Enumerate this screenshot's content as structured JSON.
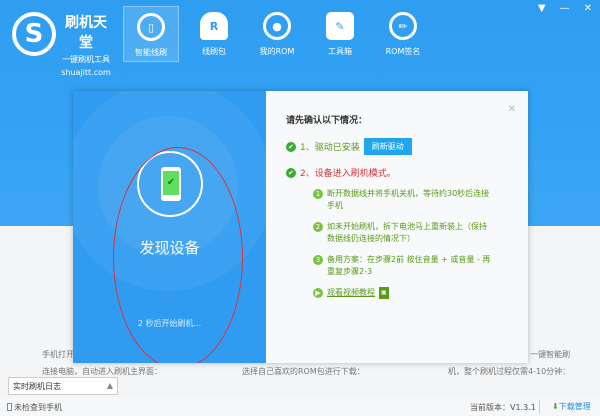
{
  "brand": {
    "name": "刷机天堂",
    "tagline": "一键刷机工具",
    "site": "shuajitt.com"
  },
  "nav": [
    {
      "label": "智能线刷",
      "icon": "phone-refresh-icon"
    },
    {
      "label": "线刷包",
      "icon": "cloud-download-icon"
    },
    {
      "label": "我的ROM",
      "icon": "user-icon"
    },
    {
      "label": "工具箱",
      "icon": "wrench-icon"
    },
    {
      "label": "ROM签名",
      "icon": "pencil-icon"
    }
  ],
  "window": {
    "menu": "▼",
    "minimize": "—",
    "close": "✕"
  },
  "background_hints": {
    "left": [
      "手机打开",
      "连接电脑，自动进入刷机主界面："
    ],
    "center": "选择自己喜欢的ROM包进行下载：",
    "right": [
      "一键智能刷",
      "机，整个刷机过程仅需4-10分钟："
    ]
  },
  "modal": {
    "found_title": "发现设备",
    "countdown": "2 秒后开始刷机...",
    "confirm_title": "请先确认以下情况：",
    "check1": "1、驱动已安装",
    "refresh_driver": "刷新驱动",
    "check2": "2、设备进入刷机模式。",
    "steps": [
      {
        "num": "1",
        "text": "断开数据线并将手机关机，等待约30秒后连接手机"
      },
      {
        "num": "2",
        "text": "如未开始刷机，拆下电池马上重新装上（保持数据线仍连接的情况下）"
      },
      {
        "num": "3",
        "text": "备用方案：在步骤2前 按住音量 + 或音量 - 再重复步骤2-3"
      }
    ],
    "video_link": "观看视频教程",
    "close": "✕"
  },
  "log_dropdown": {
    "value": "实时刷机日志",
    "arrow": "▲"
  },
  "status": {
    "device": "未检查到手机",
    "version": "当前版本：V1.3.1",
    "download": "下载管理"
  },
  "colors": {
    "accent": "#2f9df0",
    "success": "#3aaa35",
    "warning": "#d9333a",
    "step_green": "#5a9a1a"
  }
}
